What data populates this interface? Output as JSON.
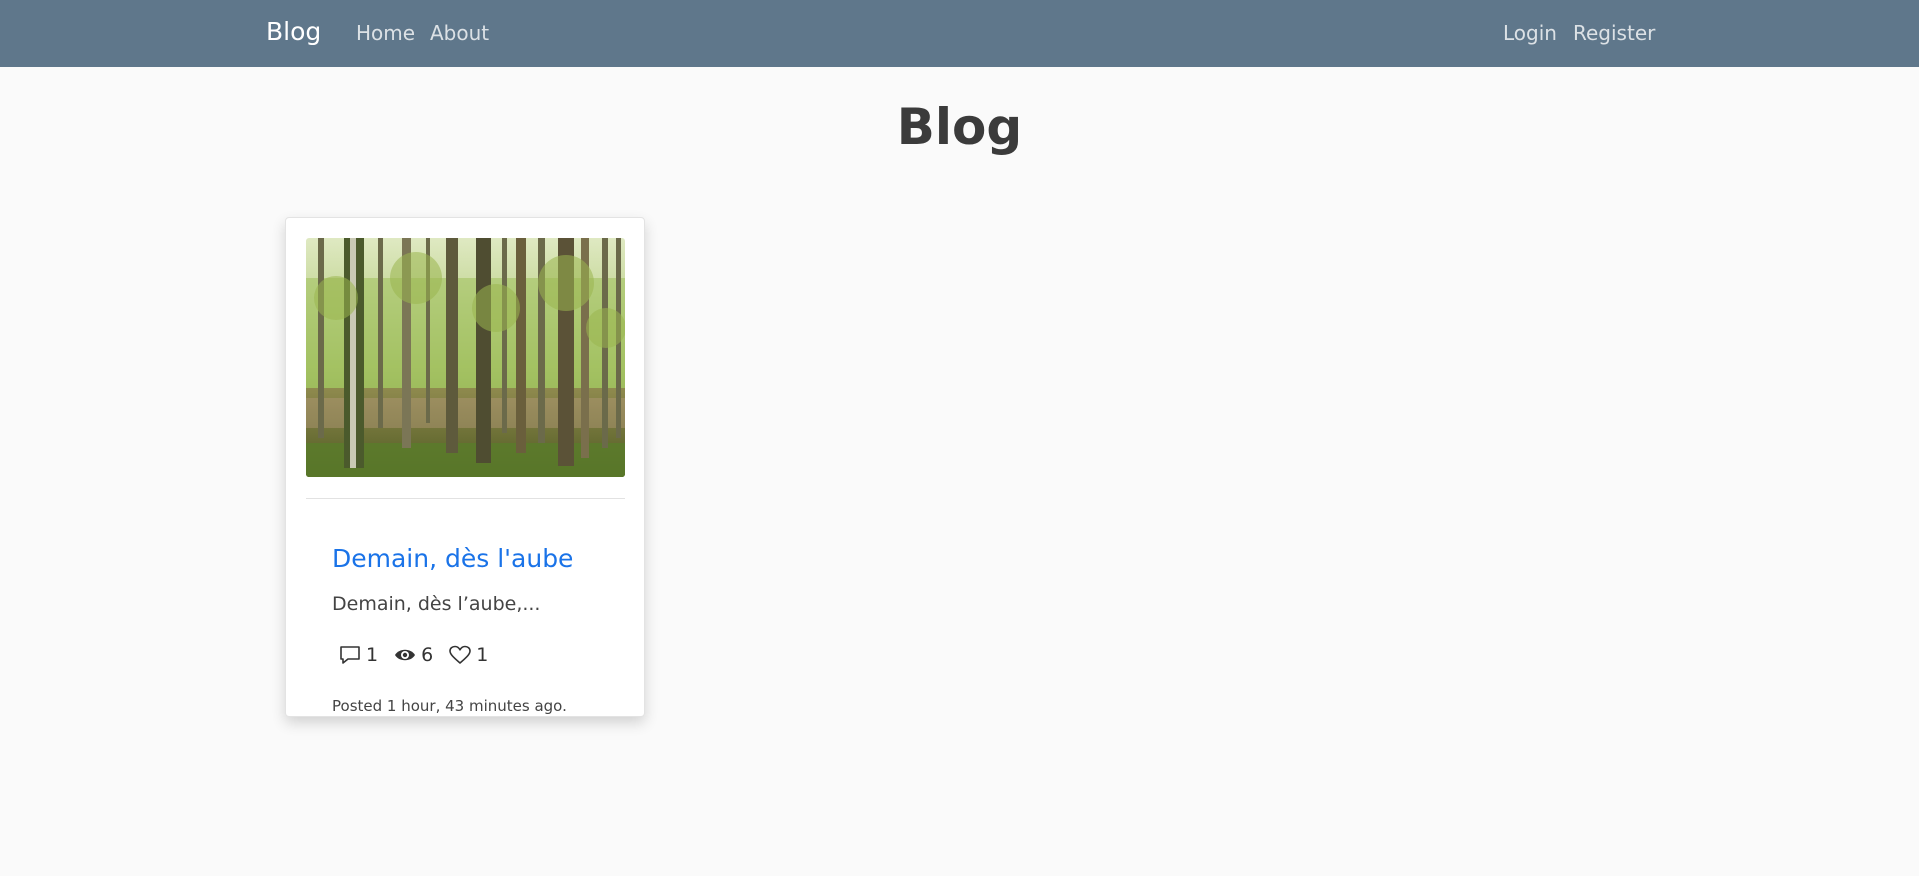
{
  "navbar": {
    "brand": "Blog",
    "left_links": [
      "Home",
      "About"
    ],
    "right_links": [
      "Login",
      "Register"
    ],
    "bg_color": "#5f778b"
  },
  "page": {
    "title": "Blog"
  },
  "posts": [
    {
      "title": "Demain, dès l'aube",
      "excerpt": "Demain, dès l’aube,...",
      "stats": {
        "comments": "1",
        "views": "6",
        "likes": "1"
      },
      "posted": "Posted 1 hour, 43 minutes ago.",
      "title_color": "#1a73e8",
      "image_icon": "forest-photo"
    }
  ]
}
